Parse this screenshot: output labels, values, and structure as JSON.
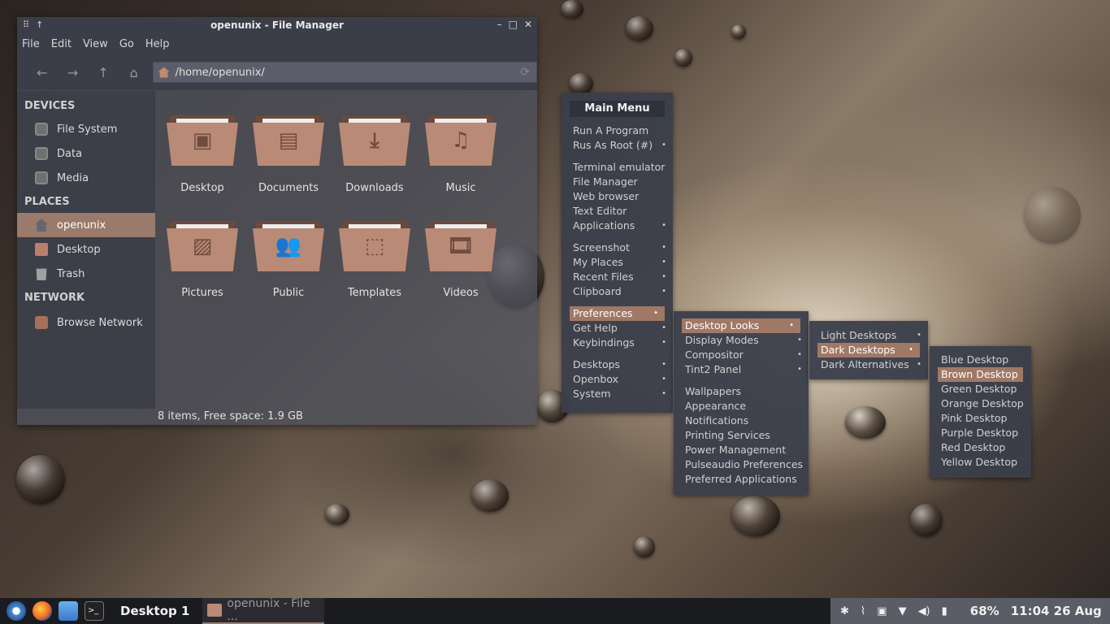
{
  "window": {
    "title": "openunix - File Manager",
    "menu": [
      "File",
      "Edit",
      "View",
      "Go",
      "Help"
    ],
    "path": "/home/openunix/",
    "status": "8 items, Free space: 1.9 GB"
  },
  "sidebar": {
    "devices_header": "DEVICES",
    "devices": [
      "File System",
      "Data",
      "Media"
    ],
    "places_header": "PLACES",
    "places": [
      "openunix",
      "Desktop",
      "Trash"
    ],
    "network_header": "NETWORK",
    "network": [
      "Browse Network"
    ]
  },
  "folders": [
    "Desktop",
    "Documents",
    "Downloads",
    "Music",
    "Pictures",
    "Public",
    "Templates",
    "Videos"
  ],
  "main_menu": {
    "title": "Main Menu",
    "items": [
      "Run A Program",
      "Rus As Root (#)",
      "Terminal emulator",
      "File Manager",
      "Web browser",
      "Text Editor",
      "Applications",
      "Screenshot",
      "My Places",
      "Recent Files",
      "Clipboard",
      "Preferences",
      "Get Help",
      "Keybindings",
      "Desktops",
      "Openbox",
      "System"
    ]
  },
  "prefs_menu": {
    "items": [
      "Desktop Looks",
      "Display Modes",
      "Compositor",
      "Tint2 Panel",
      "Wallpapers",
      "Appearance",
      "Notifications",
      "Printing Services",
      "Power Management",
      "Pulseaudio Preferences",
      "Preferred Applications"
    ]
  },
  "looks_menu": {
    "items": [
      "Light Desktops",
      "Dark Desktops",
      "Dark Alternatives"
    ]
  },
  "dark_menu": {
    "items": [
      "Blue Desktop",
      "Brown Desktop",
      "Green Desktop",
      "Orange Desktop",
      "Pink Desktop",
      "Purple Desktop",
      "Red Desktop",
      "Yellow Desktop"
    ]
  },
  "taskbar": {
    "workspace": "Desktop 1",
    "task": "openunix - File ...",
    "battery": "68%",
    "clock": "11:04 26 Aug"
  },
  "colors": {
    "accent": "#a07866",
    "panel": "#3b3e49",
    "taskbar": "#1a1b1f"
  }
}
